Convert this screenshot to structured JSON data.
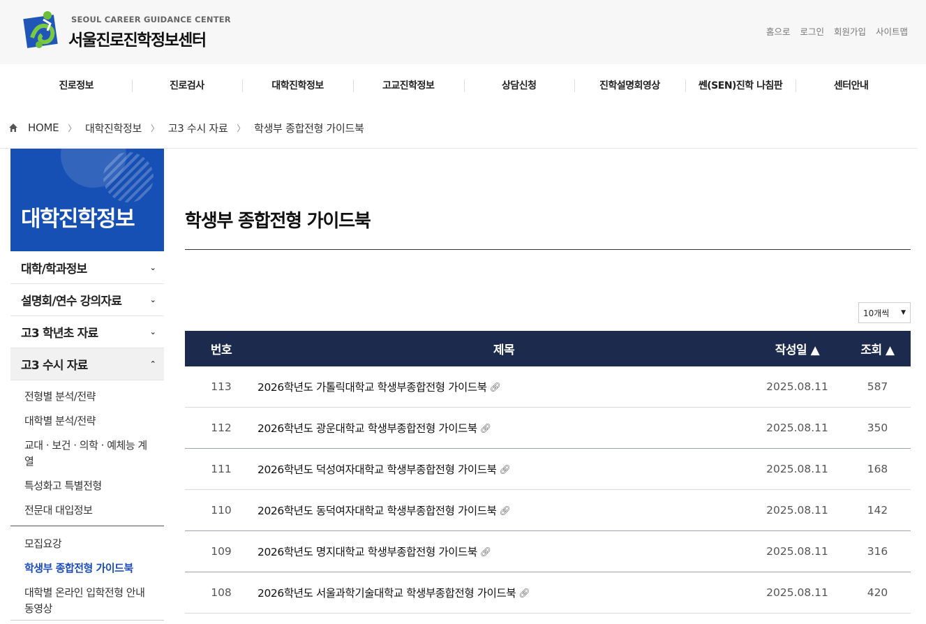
{
  "header": {
    "logo_en": "SEOUL CAREER GUIDANCE CENTER",
    "logo_ko": "서울진로진학정보센터",
    "util_links": [
      "홈으로",
      "로그인",
      "회원가입",
      "사이트맵"
    ]
  },
  "gnb": [
    "진로정보",
    "진로검사",
    "대학진학정보",
    "고교진학정보",
    "상담신청",
    "진학설명회영상",
    "쎈(SEN)진학 나침판",
    "센터안내"
  ],
  "breadcrumb": [
    "HOME",
    "대학진학정보",
    "고3 수시 자료",
    "학생부 종합전형 가이드북"
  ],
  "sidebar": {
    "title": "대학진학정보",
    "menu": [
      {
        "label": "대학/학과정보",
        "chevron": "⌄"
      },
      {
        "label": "설명회/연수 강의자료",
        "chevron": "⌄"
      },
      {
        "label": "고3 학년초 자료",
        "chevron": "⌄"
      },
      {
        "label": "고3 수시 자료",
        "chevron": "⌃"
      }
    ],
    "sub_group1": [
      "전형별 분석/전략",
      "대학별 분석/전략",
      "교대 · 보건 · 의학 · 예체능 계열",
      "특성화고 특별전형",
      "전문대 대입정보"
    ],
    "sub_group2": [
      "모집요강",
      "학생부 종합전형 가이드북",
      "대학별 온라인 입학전형 안내 동영상"
    ]
  },
  "main": {
    "title": "학생부 종합전형 가이드북",
    "per_page": "10개씩",
    "table": {
      "headers": {
        "no": "번호",
        "title": "제목",
        "date": "작성일 ▲",
        "views": "조회 ▲"
      },
      "rows": [
        {
          "no": "113",
          "title": "2026학년도 가톨릭대학교 학생부종합전형 가이드북",
          "date": "2025.08.11",
          "views": "587"
        },
        {
          "no": "112",
          "title": "2026학년도 광운대학교 학생부종합전형 가이드북",
          "date": "2025.08.11",
          "views": "350"
        },
        {
          "no": "111",
          "title": "2026학년도 덕성여자대학교 학생부종합전형 가이드북",
          "date": "2025.08.11",
          "views": "168"
        },
        {
          "no": "110",
          "title": "2026학년도 동덕여자대학교 학생부종합전형 가이드북",
          "date": "2025.08.11",
          "views": "142"
        },
        {
          "no": "109",
          "title": "2026학년도 명지대학교 학생부종합전형 가이드북",
          "date": "2025.08.11",
          "views": "316"
        },
        {
          "no": "108",
          "title": "2026학년도 서울과학기술대학교 학생부종합전형 가이드북",
          "date": "2025.08.11",
          "views": "420"
        }
      ]
    }
  },
  "colors": {
    "brand_blue": "#1750b4",
    "table_header": "#1c2a4d",
    "active_link": "#1a4bbd"
  }
}
